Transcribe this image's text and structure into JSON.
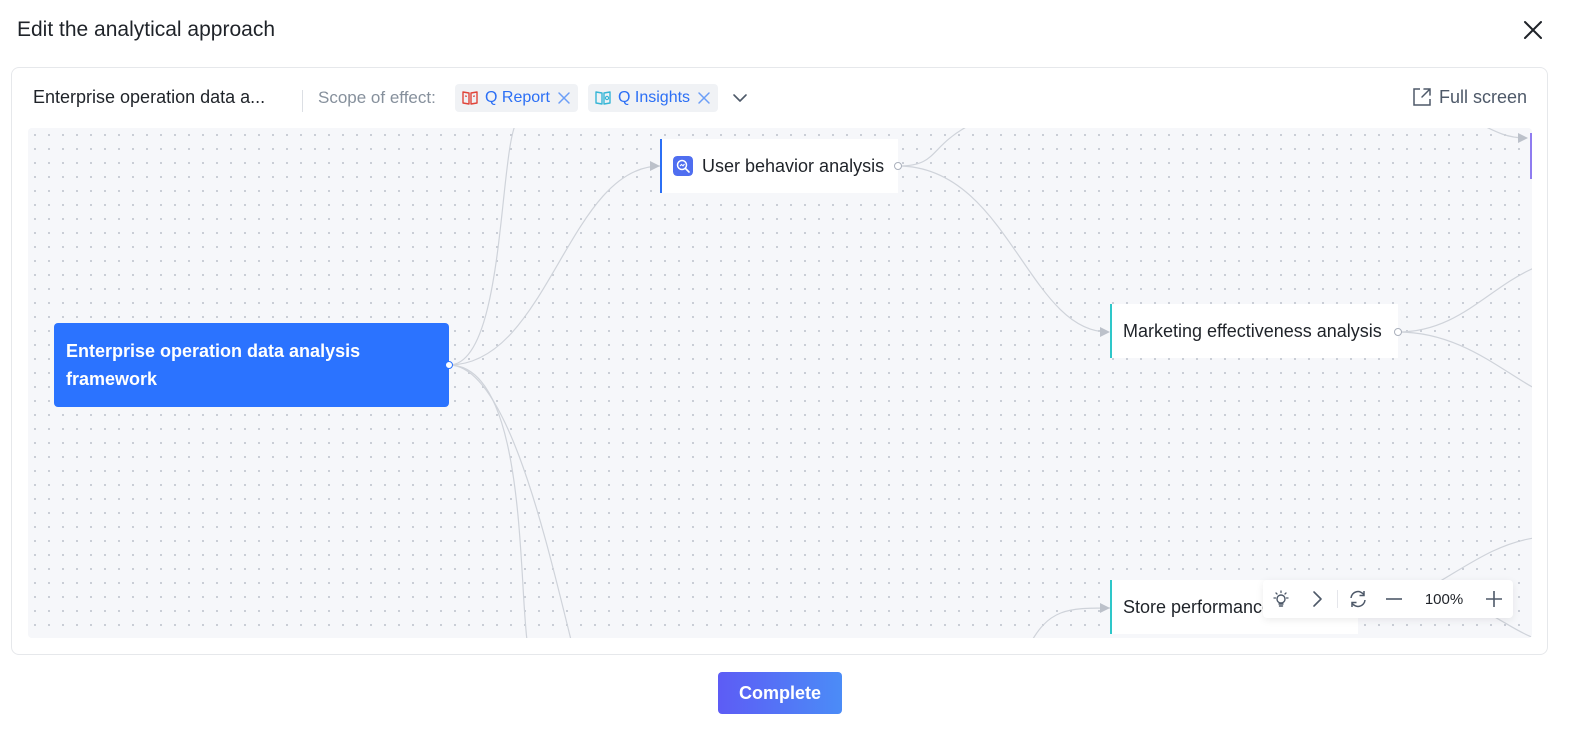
{
  "modal": {
    "title": "Edit the analytical approach",
    "close_icon": "close-icon"
  },
  "toolbar": {
    "doc_name": "Enterprise operation data a...",
    "scope_label": "Scope of effect:",
    "tags": [
      {
        "label": "Q Report",
        "icon": "report-book-icon",
        "icon_color": "#e0453a"
      },
      {
        "label": "Q Insights",
        "icon": "insights-book-icon",
        "icon_color": "#37b6d6"
      }
    ],
    "dropdown_icon": "chevron-down-icon",
    "fullscreen_label": "Full screen"
  },
  "canvas": {
    "root_node": "Enterprise operation data analysis framework",
    "nodes": [
      {
        "label": "User behavior analysis",
        "icon": "user-analysis-icon",
        "accent": "#2b6ff5"
      },
      {
        "label": "Marketing effectiveness analysis",
        "accent": "#2ec7c9"
      },
      {
        "label": "Store performance analysis",
        "accent": "#2ec7c9"
      }
    ],
    "zoom": "100%"
  },
  "colors": {
    "primary": "#2b73ff",
    "teal": "#2ec7c9",
    "button_gradient_start": "#5d5cf5",
    "button_gradient_end": "#4b8cf7"
  },
  "footer": {
    "complete_label": "Complete"
  }
}
